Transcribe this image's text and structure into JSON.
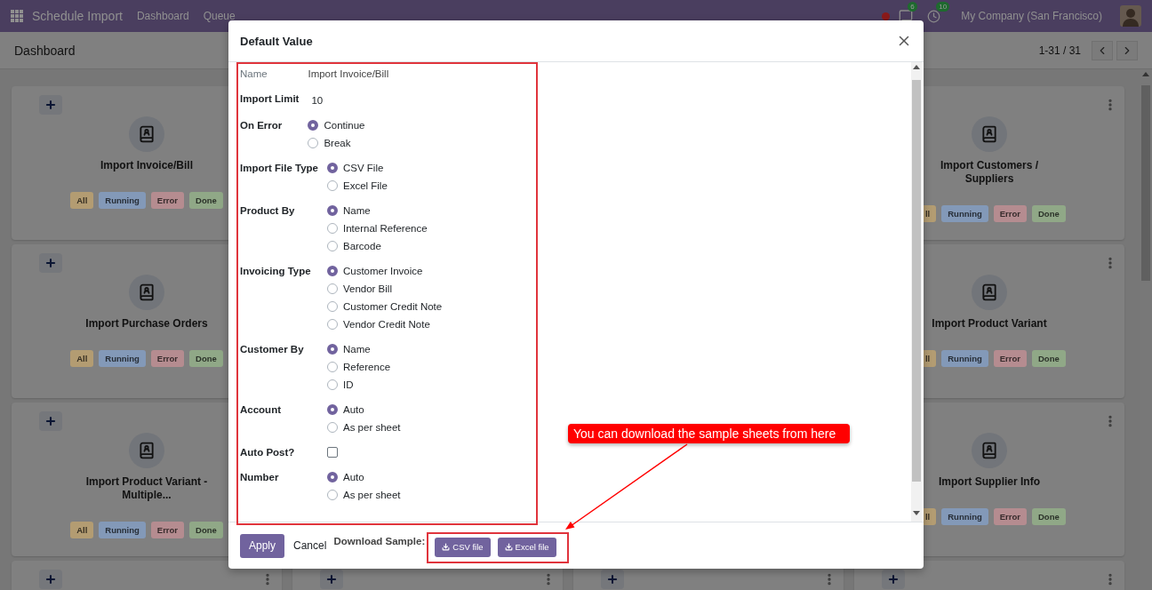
{
  "navbar": {
    "app_name": "Schedule Import",
    "menu": [
      {
        "label": "Dashboard"
      },
      {
        "label": "Queue"
      }
    ],
    "messages_count": "6",
    "activities_count": "10",
    "company": "My Company (San Francisco)"
  },
  "control_panel": {
    "breadcrumb": "Dashboard",
    "pager": "1-31 / 31"
  },
  "card_rows": [
    {
      "left": {
        "title": "Import Invoice/Bill",
        "badges": [
          {
            "label": "All",
            "color": "#b39c72"
          },
          {
            "label": "Running",
            "color": "#8399b8"
          },
          {
            "label": "Error",
            "color": "#b58c90"
          },
          {
            "label": "Done",
            "color": "#90a887"
          }
        ]
      },
      "right": {
        "title": "Import Customers / Suppliers",
        "badges": [
          {
            "label": "ll",
            "color": "#b39c72"
          },
          {
            "label": "Running",
            "color": "#8399b8"
          },
          {
            "label": "Error",
            "color": "#b58c90"
          },
          {
            "label": "Done",
            "color": "#90a887"
          }
        ]
      }
    },
    {
      "left": {
        "title": "Import Purchase Orders",
        "badges": [
          {
            "label": "All",
            "color": "#b39c72"
          },
          {
            "label": "Running",
            "color": "#8399b8"
          },
          {
            "label": "Error",
            "color": "#b58c90"
          },
          {
            "label": "Done",
            "color": "#90a887"
          }
        ]
      },
      "right": {
        "title": "Import Product Variant",
        "badges": [
          {
            "label": "ll",
            "color": "#b39c72"
          },
          {
            "label": "Running",
            "color": "#8399b8"
          },
          {
            "label": "Error",
            "color": "#b58c90"
          },
          {
            "label": "Done",
            "color": "#90a887"
          }
        ]
      }
    },
    {
      "left": {
        "title": "Import Product Variant - Multiple...",
        "badges": [
          {
            "label": "All",
            "color": "#b39c72"
          },
          {
            "label": "Running",
            "color": "#8399b8"
          },
          {
            "label": "Error",
            "color": "#b58c90"
          },
          {
            "label": "Done",
            "color": "#90a887"
          }
        ]
      },
      "right": {
        "title": "Import Supplier Info",
        "badges": [
          {
            "label": "ll",
            "color": "#b39c72"
          },
          {
            "label": "Running",
            "color": "#8399b8"
          },
          {
            "label": "Error",
            "color": "#b58c90"
          },
          {
            "label": "Done",
            "color": "#90a887"
          }
        ]
      }
    }
  ],
  "dialog": {
    "title": "Default Value",
    "groups": [
      {
        "fields": [
          {
            "kind": "readonly",
            "label": "Name",
            "value": "Import Invoice/Bill"
          },
          {
            "kind": "text",
            "label": "Import Limit",
            "value": "10"
          },
          {
            "kind": "radio",
            "label": "On Error",
            "options": [
              {
                "label": "Continue",
                "selected": true
              },
              {
                "label": "Break",
                "selected": false
              }
            ]
          }
        ]
      },
      {
        "fields": [
          {
            "kind": "radio",
            "label": "Import File Type",
            "options": [
              {
                "label": "CSV File",
                "selected": true
              },
              {
                "label": "Excel File",
                "selected": false
              }
            ]
          },
          {
            "kind": "radio",
            "label": "Product By",
            "options": [
              {
                "label": "Name",
                "selected": true
              },
              {
                "label": "Internal Reference",
                "selected": false
              },
              {
                "label": "Barcode",
                "selected": false
              }
            ]
          },
          {
            "kind": "radio",
            "label": "Invoicing Type",
            "options": [
              {
                "label": "Customer Invoice",
                "selected": true
              },
              {
                "label": "Vendor Bill",
                "selected": false
              },
              {
                "label": "Customer Credit Note",
                "selected": false
              },
              {
                "label": "Vendor Credit Note",
                "selected": false
              }
            ]
          },
          {
            "kind": "radio",
            "label": "Customer By",
            "options": [
              {
                "label": "Name",
                "selected": true
              },
              {
                "label": "Reference",
                "selected": false
              },
              {
                "label": "ID",
                "selected": false
              }
            ]
          },
          {
            "kind": "radio",
            "label": "Account",
            "options": [
              {
                "label": "Auto",
                "selected": true
              },
              {
                "label": "As per sheet",
                "selected": false
              }
            ]
          },
          {
            "kind": "checkbox",
            "label": "Auto Post?",
            "checked": false
          },
          {
            "kind": "radio",
            "label": "Number",
            "options": [
              {
                "label": "Auto",
                "selected": true
              },
              {
                "label": "As per sheet",
                "selected": false
              }
            ]
          }
        ]
      }
    ],
    "footer": {
      "apply": "Apply",
      "cancel": "Cancel",
      "download_label": "Download Sample:",
      "downloads": [
        {
          "label": "CSV file"
        },
        {
          "label": "Excel file"
        }
      ]
    },
    "callout": "You can download the sample sheets from here"
  }
}
